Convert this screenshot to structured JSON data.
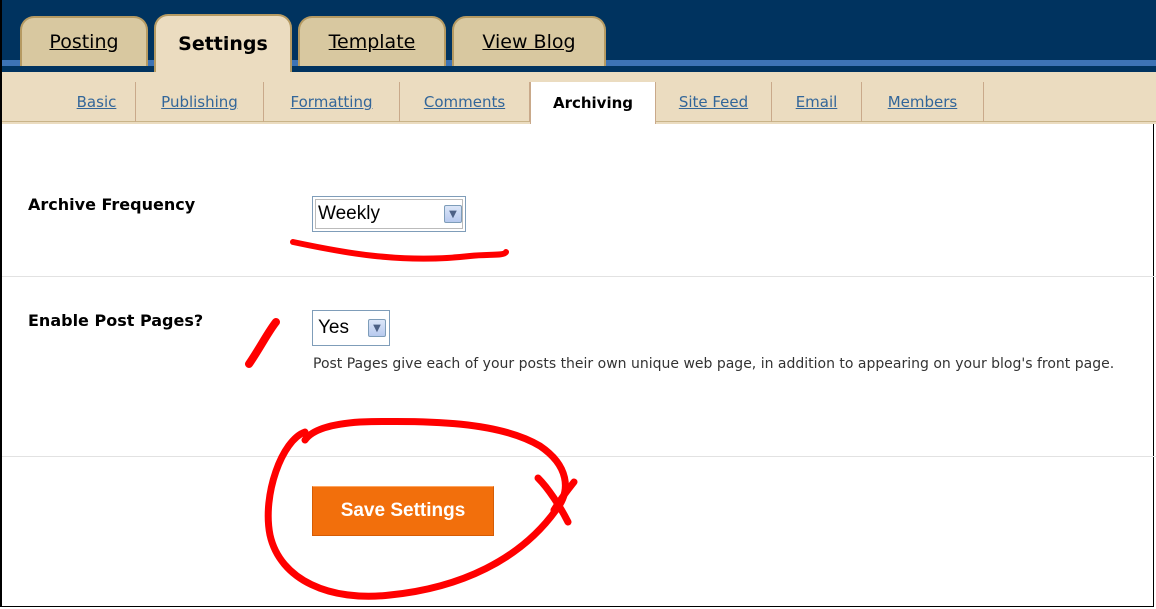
{
  "main_tabs": [
    {
      "label": "Posting",
      "active": false
    },
    {
      "label": "Settings",
      "active": true
    },
    {
      "label": "Template",
      "active": false
    },
    {
      "label": "View Blog",
      "active": false
    }
  ],
  "sub_tabs": [
    {
      "label": "Basic",
      "active": false
    },
    {
      "label": "Publishing",
      "active": false
    },
    {
      "label": "Formatting",
      "active": false
    },
    {
      "label": "Comments",
      "active": false
    },
    {
      "label": "Archiving",
      "active": true
    },
    {
      "label": "Site Feed",
      "active": false
    },
    {
      "label": "Email",
      "active": false
    },
    {
      "label": "Members",
      "active": false
    }
  ],
  "archive_frequency": {
    "label": "Archive Frequency",
    "value": "Weekly"
  },
  "post_pages": {
    "label": "Enable Post Pages?",
    "value": "Yes",
    "help": "Post Pages give each of your posts their own unique web page, in addition to appearing on your blog's front page."
  },
  "save_label": "Save Settings",
  "colors": {
    "header": "#00335f",
    "accent_stripe": "#3d73b5",
    "tab": "#ebdcc0",
    "link": "#336699",
    "save": "#f26f0c",
    "annotation": "#ff0000"
  },
  "icons": {
    "dropdown": "chevron-down-icon"
  }
}
